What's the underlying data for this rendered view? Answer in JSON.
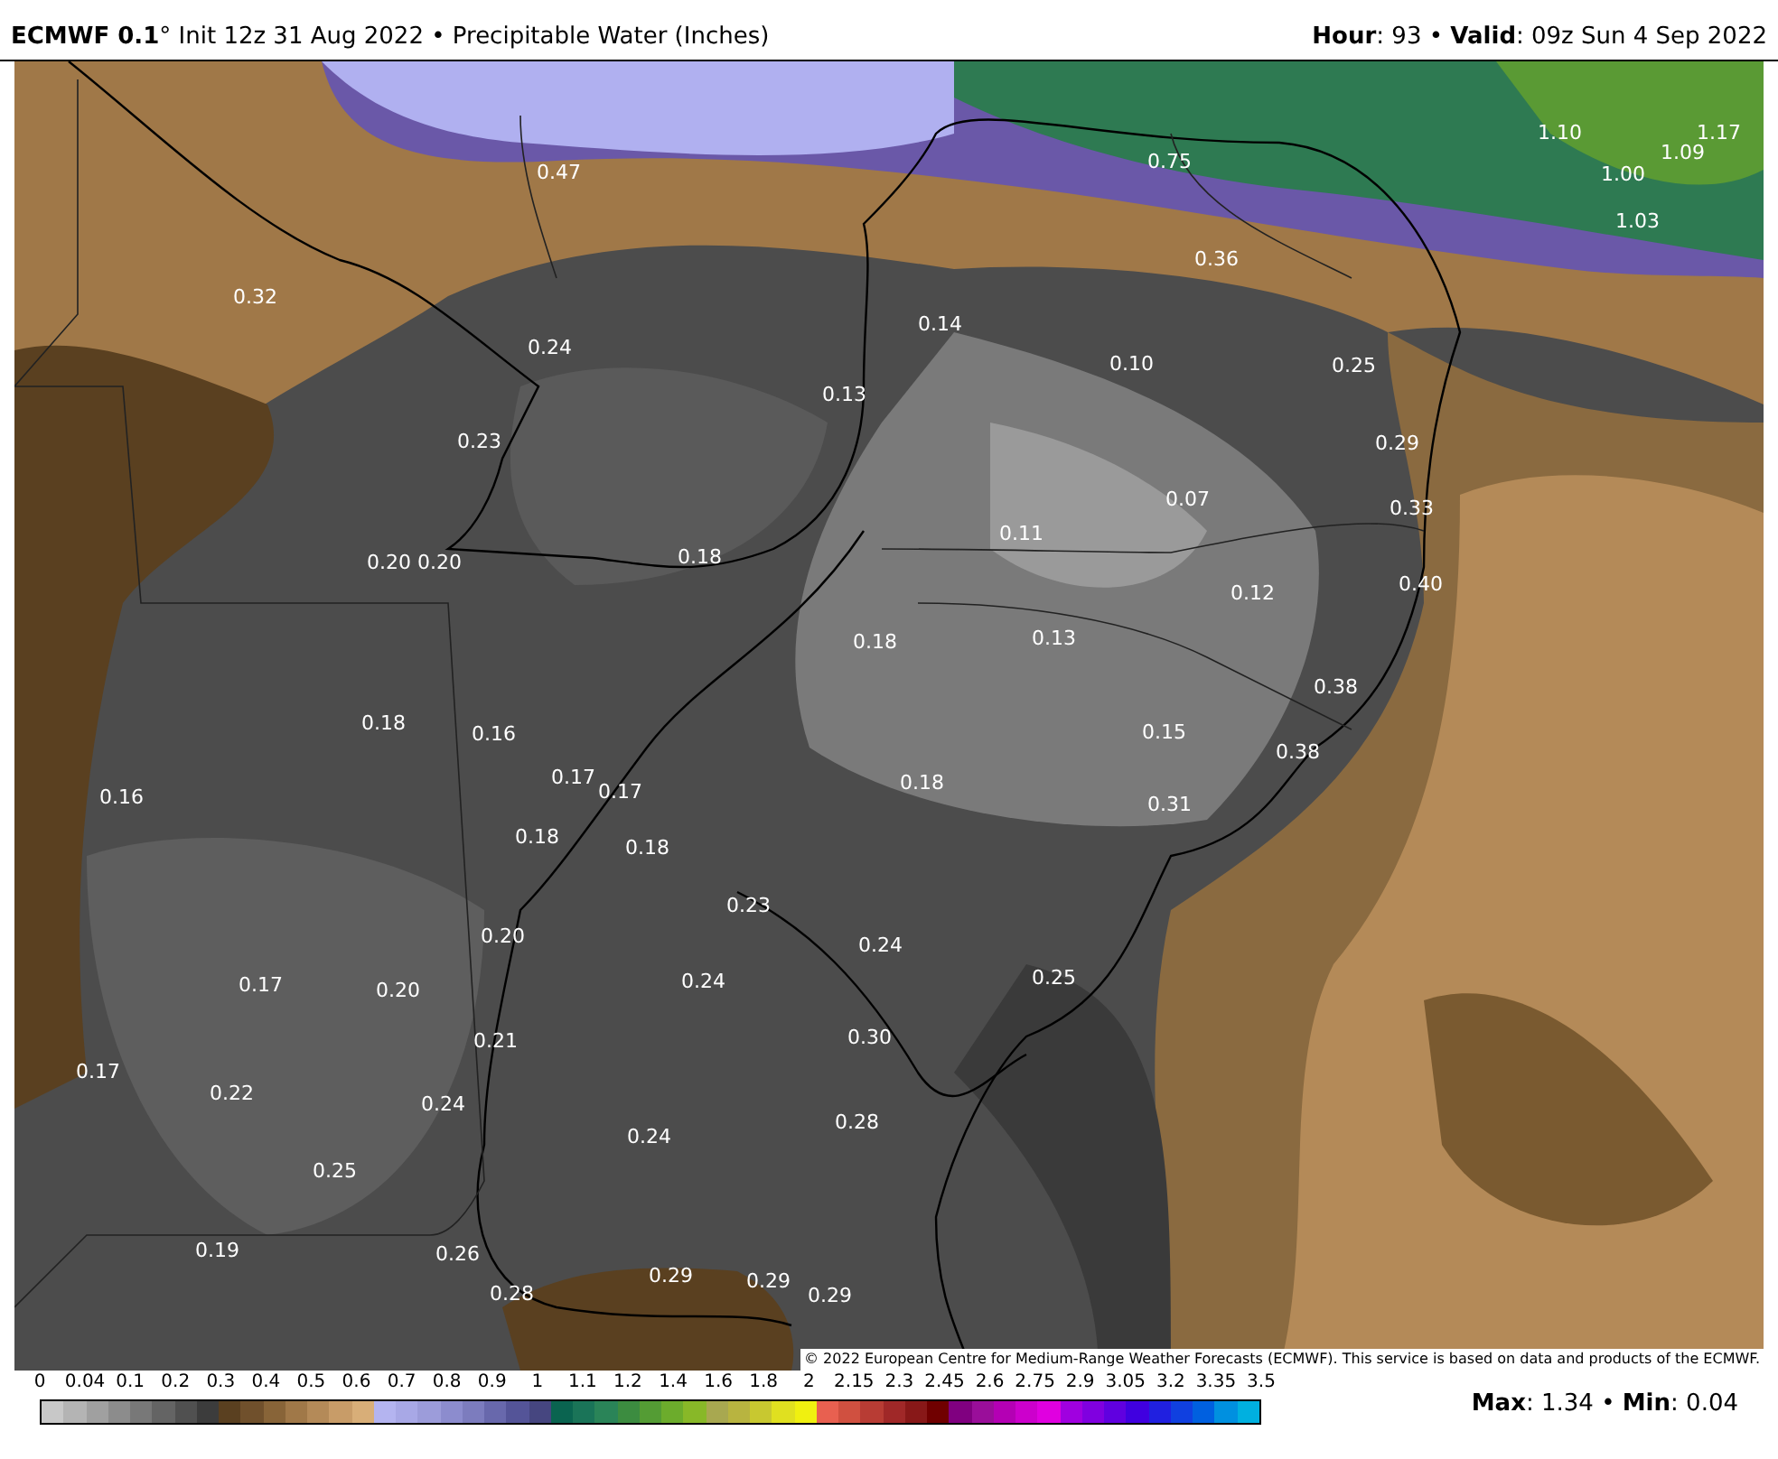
{
  "header": {
    "title": "**ECMWF 0.1**° Init 12z 31 Aug 2022 • Precipitable Water (Inches)",
    "valid": "**Hour**: 93 • **Valid**: 09z Sun 4 Sep 2022"
  },
  "map": {
    "labels": [
      "0.47",
      "0.75",
      "1.10",
      "1.17",
      "1.09",
      "1.00",
      "1.03",
      "0.32",
      "0.36",
      "0.24",
      "0.14",
      "0.10",
      "0.25",
      "0.13",
      "0.23",
      "0.29",
      "0.07",
      "0.33",
      "0.11",
      "0.20",
      "0.20",
      "0.18",
      "0.40",
      "0.12",
      "0.18",
      "0.13",
      "0.38",
      "0.18",
      "0.16",
      "0.15",
      "0.38",
      "0.16",
      "0.17",
      "0.17",
      "0.18",
      "0.31",
      "0.18",
      "0.18",
      "0.23",
      "0.24",
      "0.20",
      "0.17",
      "0.20",
      "0.24",
      "0.25",
      "0.21",
      "0.30",
      "0.17",
      "0.22",
      "0.24",
      "0.28",
      "0.24",
      "0.25",
      "0.19",
      "0.26",
      "0.28",
      "0.29",
      "0.29",
      "0.29"
    ],
    "credit": "© 2022 European Centre for Medium-Range Weather Forecasts (ECMWF). This service is based on data and products of the ECMWF."
  },
  "legend": {
    "ticks": [
      "0",
      "0.04",
      "0.1",
      "0.2",
      "0.3",
      "0.4",
      "0.5",
      "0.6",
      "0.7",
      "0.8",
      "0.9",
      "1",
      "1.1",
      "1.2",
      "1.4",
      "1.6",
      "1.8",
      "2",
      "2.15",
      "2.3",
      "2.45",
      "2.6",
      "2.75",
      "2.9",
      "3.05",
      "3.2",
      "3.35",
      "3.5"
    ],
    "swatches": [
      {
        "color": "#c8c8c8"
      },
      {
        "color": "#b4b4b4"
      },
      {
        "color": "#a0a0a0"
      },
      {
        "color": "#8c8c8c"
      },
      {
        "color": "#787878"
      },
      {
        "color": "#646464"
      },
      {
        "color": "#505050"
      },
      {
        "color": "#3c3c3c"
      },
      {
        "color": "#5a4020"
      },
      {
        "color": "#70502c"
      },
      {
        "color": "#886438"
      },
      {
        "color": "#a07848"
      },
      {
        "color": "#b48a58"
      },
      {
        "color": "#c89c68"
      },
      {
        "color": "#d8ae78"
      },
      {
        "color": "#b4b4f0"
      },
      {
        "color": "#a8a8e6"
      },
      {
        "color": "#9c9cda"
      },
      {
        "color": "#8c8cce"
      },
      {
        "color": "#7c7cbe"
      },
      {
        "color": "#6868ac"
      },
      {
        "color": "#545498"
      },
      {
        "color": "#464680"
      },
      {
        "color": "#0a6450"
      },
      {
        "color": "#1a7458"
      },
      {
        "color": "#2a8458"
      },
      {
        "color": "#3c8c40"
      },
      {
        "color": "#549c34"
      },
      {
        "color": "#6cac2c"
      },
      {
        "color": "#88b828"
      },
      {
        "color": "#a8a850"
      },
      {
        "color": "#b8b440"
      },
      {
        "color": "#c8c830"
      },
      {
        "color": "#e0e020"
      },
      {
        "color": "#f0f010"
      },
      {
        "color": "#e86050"
      },
      {
        "color": "#d05040"
      },
      {
        "color": "#b83c34"
      },
      {
        "color": "#a02828"
      },
      {
        "color": "#881818"
      },
      {
        "color": "#700000"
      },
      {
        "color": "#800080"
      },
      {
        "color": "#9a0e9a"
      },
      {
        "color": "#b400b4"
      },
      {
        "color": "#cc00cc"
      },
      {
        "color": "#e000e0"
      },
      {
        "color": "#a000e0"
      },
      {
        "color": "#8000e0"
      },
      {
        "color": "#6000e0"
      },
      {
        "color": "#4000e0"
      },
      {
        "color": "#2020e0"
      },
      {
        "color": "#1040e0"
      },
      {
        "color": "#0060e0"
      },
      {
        "color": "#0090e0"
      },
      {
        "color": "#00b0e0"
      }
    ],
    "stats": "**Max**: 1.34 • **Min**: 0.04"
  }
}
